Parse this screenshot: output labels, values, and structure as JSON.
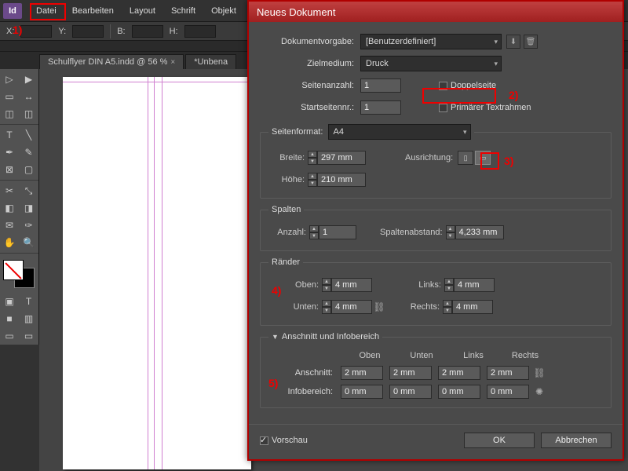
{
  "menu": {
    "items": [
      "Datei",
      "Bearbeiten",
      "Layout",
      "Schrift",
      "Objekt"
    ],
    "logo": "Id"
  },
  "controlbar": {
    "x_label": "X:",
    "y_label": "Y:",
    "w_label": "B:",
    "h_label": "H:"
  },
  "tabs": [
    {
      "label": "Schulflyer DIN A5.indd @ 56 %",
      "close": "×"
    },
    {
      "label": "*Unbena",
      "close": "×"
    }
  ],
  "dialog": {
    "title": "Neues Dokument",
    "preset_label": "Dokumentvorgabe:",
    "preset_value": "[Benutzerdefiniert]",
    "intent_label": "Zielmedium:",
    "intent_value": "Druck",
    "pages_label": "Seitenanzahl:",
    "pages_value": "1",
    "facing_label": "Doppelseite",
    "startpage_label": "Startseitennr.:",
    "startpage_value": "1",
    "primary_label": "Primärer Textrahmen",
    "pagesize_legend": "Seitenformat:",
    "pagesize_value": "A4",
    "width_label": "Breite:",
    "width_value": "297 mm",
    "height_label": "Höhe:",
    "height_value": "210 mm",
    "orient_label": "Ausrichtung:",
    "columns_legend": "Spalten",
    "cols_label": "Anzahl:",
    "cols_value": "1",
    "gutter_label": "Spaltenabstand:",
    "gutter_value": "4,233 mm",
    "margins_legend": "Ränder",
    "m_top_label": "Oben:",
    "m_top": "4 mm",
    "m_bottom_label": "Unten:",
    "m_bottom": "4 mm",
    "m_left_label": "Links:",
    "m_left": "4 mm",
    "m_right_label": "Rechts:",
    "m_right": "4 mm",
    "bleed_legend": "Anschnitt und Infobereich",
    "col_top": "Oben",
    "col_bottom": "Unten",
    "col_left": "Links",
    "col_right": "Rechts",
    "bleed_label": "Anschnitt:",
    "bleed_t": "2 mm",
    "bleed_b": "2 mm",
    "bleed_l": "2 mm",
    "bleed_r": "2 mm",
    "slug_label": "Infobereich:",
    "slug_t": "0 mm",
    "slug_b": "0 mm",
    "slug_l": "0 mm",
    "slug_r": "0 mm",
    "preview_label": "Vorschau",
    "ok": "OK",
    "cancel": "Abbrechen"
  },
  "ann": {
    "n1": "1)",
    "n2": "2)",
    "n3": "3)",
    "n4": "4)",
    "n5": "5)"
  }
}
